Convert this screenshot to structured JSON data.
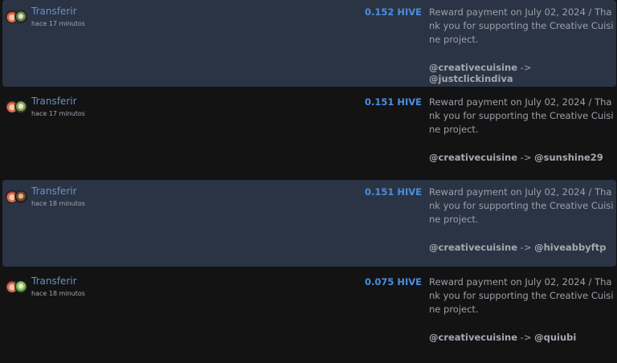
{
  "transactions": [
    {
      "type_label": "Transferir",
      "time": "hace 17 minutos",
      "amount": "0.152 HIVE",
      "memo": "Reward payment on July 02, 2024 / Thank you for supporting the Creative Cuisine project.",
      "from": "@creativecuisine",
      "arrow": "->",
      "to": "@justclickindiva"
    },
    {
      "type_label": "Transferir",
      "time": "hace 17 minutos",
      "amount": "0.151 HIVE",
      "memo": "Reward payment on July 02, 2024 / Thank you for supporting the Creative Cuisine project.",
      "from": "@creativecuisine",
      "arrow": "->",
      "to": "@sunshine29"
    },
    {
      "type_label": "Transferir",
      "time": "hace 18 minutos",
      "amount": "0.151 HIVE",
      "memo": "Reward payment on July 02, 2024 / Thank you for supporting the Creative Cuisine project.",
      "from": "@creativecuisine",
      "arrow": "->",
      "to": "@hiveabbyftp"
    },
    {
      "type_label": "Transferir",
      "time": "hace 18 minutos",
      "amount": "0.075 HIVE",
      "memo": "Reward payment on July 02, 2024 / Thank you for supporting the Creative Cuisine project.",
      "from": "@creativecuisine",
      "arrow": "->",
      "to": "@quiubi"
    }
  ],
  "colors": {
    "background": "#131314",
    "row_highlight": "#2b3444",
    "link": "#6f8fc4",
    "amount": "#4a8fe0",
    "muted_text": "#9aa0a7"
  }
}
